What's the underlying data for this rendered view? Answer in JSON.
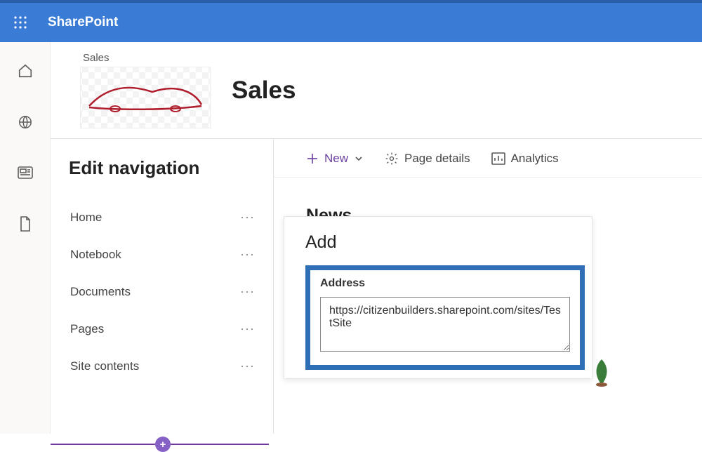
{
  "header": {
    "brand": "SharePoint"
  },
  "site": {
    "breadcrumb": "Sales",
    "title": "Sales"
  },
  "nav": {
    "title": "Edit navigation",
    "items": [
      {
        "label": "Home"
      },
      {
        "label": "Notebook"
      },
      {
        "label": "Documents"
      },
      {
        "label": "Pages"
      },
      {
        "label": "Site contents"
      }
    ]
  },
  "toolbar": {
    "new_label": "New",
    "page_details_label": "Page details",
    "analytics_label": "Analytics"
  },
  "news": {
    "heading": "News"
  },
  "add_dialog": {
    "title": "Add",
    "address_label": "Address",
    "address_value": "https://citizenbuilders.sharepoint.com/sites/TestSite"
  }
}
